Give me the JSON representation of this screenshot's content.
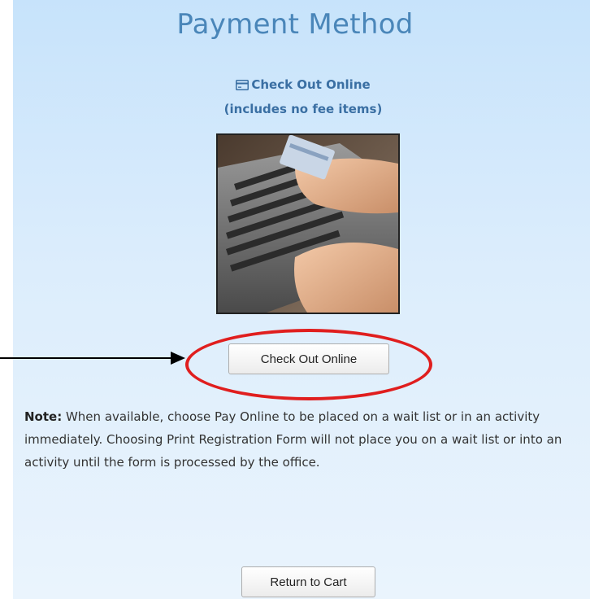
{
  "page": {
    "title": "Payment Method"
  },
  "method": {
    "icon": "credit-card-icon",
    "heading": "Check Out Online",
    "subheading": "(includes no fee items)",
    "image_alt": "hands-typing-credit-card-photo"
  },
  "buttons": {
    "check_out_online": "Check Out Online",
    "return_to_cart": "Return to Cart"
  },
  "note": {
    "label": "Note:",
    "text": " When available, choose Pay Online to be placed on a wait list or in an activity immediately. Choosing Print Registration Form will not place you on a wait list or into an activity until the form is processed by the office."
  },
  "annotations": {
    "highlight_color": "#e01e1e",
    "arrow_color": "#000000"
  }
}
